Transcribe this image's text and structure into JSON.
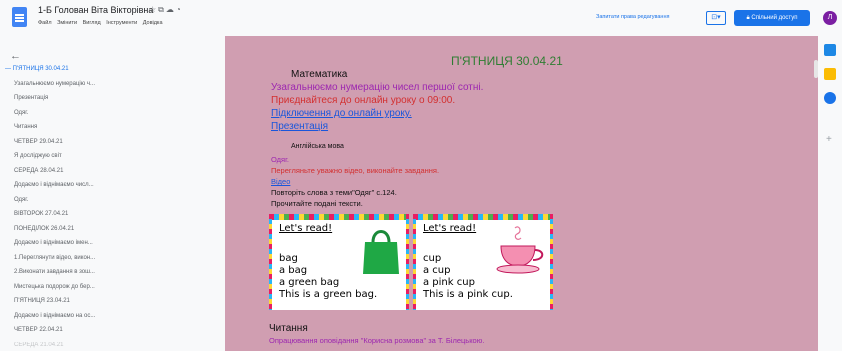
{
  "header": {
    "title": "1-Б Голован Віта Вікторівна",
    "title_icons": [
      "star-icon",
      "move-icon",
      "cloud-icon",
      "history-icon"
    ],
    "menu": [
      "Файл",
      "Змінити",
      "Вигляд",
      "Інструменти",
      "Довідка"
    ],
    "request_edit": "Запитати права редагування",
    "mode_symbol": "⊡▾",
    "share_label": "Спільний доступ",
    "avatar_letter": "Л",
    "colors": {
      "accent": "#1a73e8",
      "avatar": "#7b1fa2"
    }
  },
  "outline": {
    "back_icon": "back-arrow-icon",
    "items": [
      {
        "label": "П'ЯТНИЦЯ 30.04.21",
        "active": true
      },
      {
        "label": "Узагальнюємо нумерацію ч..."
      },
      {
        "label": "Презентація"
      },
      {
        "label": "Одяг."
      },
      {
        "label": "Читання"
      },
      {
        "label": "ЧЕТВЕР 29.04.21"
      },
      {
        "label": "Я досліджую світ"
      },
      {
        "label": "СЕРЕДА 28.04.21"
      },
      {
        "label": "Додаємо і віднімаємо числ..."
      },
      {
        "label": "Одяг."
      },
      {
        "label": "ВІВТОРОК 27.04.21"
      },
      {
        "label": "ПОНЕДІЛОК 26.04.21"
      },
      {
        "label": "Додаємо і віднімаємо імен..."
      },
      {
        "label": "1.Переглянути відео, викон..."
      },
      {
        "label": "2.Виконати завдання в зош..."
      },
      {
        "label": "Мистецька подорож до бер..."
      },
      {
        "label": "П'ЯТНИЦЯ 23.04.21"
      },
      {
        "label": "Додаємо і віднімаємо на ос..."
      },
      {
        "label": "ЧЕТВЕР 22.04.21"
      },
      {
        "label": "СЕРЕДА 21.04.21"
      }
    ]
  },
  "document": {
    "day_heading": "П'ЯТНИЦЯ 30.04.21",
    "math_heading": "Математика",
    "math_line1": "Узагальнюємо нумерацію чисел першої сотні.",
    "math_line2": "Приєднайтеся до онлайн уроку о 09:00.",
    "math_link1": "Підключення до онлайн уроку.",
    "math_link2": "Презентація",
    "english_heading": "Англійська мова",
    "english_topic": "Одяг.",
    "english_line1": "Перегляньте уважно відео, виконайте завдання.",
    "english_link": "Відео",
    "english_line2": "Повторіть слова з теми\"Одяг\" с.124.",
    "english_line3": "Прочитайте подані тексти.",
    "card1": {
      "heading": "Let's read!",
      "lines": [
        "bag",
        "a bag",
        "a green bag",
        "This is a green bag."
      ],
      "icon": "green-bag-icon"
    },
    "card2": {
      "heading": "Let's read!",
      "lines": [
        "cup",
        "a cup",
        "a pink cup",
        "This is a pink cup."
      ],
      "icon": "pink-cup-icon"
    },
    "reading_heading": "Читання",
    "reading_line1": "Опрацювання оповідання \"Корисна розмова\" за Т. Білецькою.",
    "colors": {
      "page_bg": "#d09eb1",
      "heading_green": "#2e7d32",
      "purple": "#9c27b0",
      "red": "#d32f2f",
      "link_blue": "#1a56db",
      "black": "#111111"
    }
  },
  "right_sidebar": {
    "icons": [
      "calendar-icon",
      "keep-icon",
      "tasks-icon",
      "add-icon"
    ]
  }
}
